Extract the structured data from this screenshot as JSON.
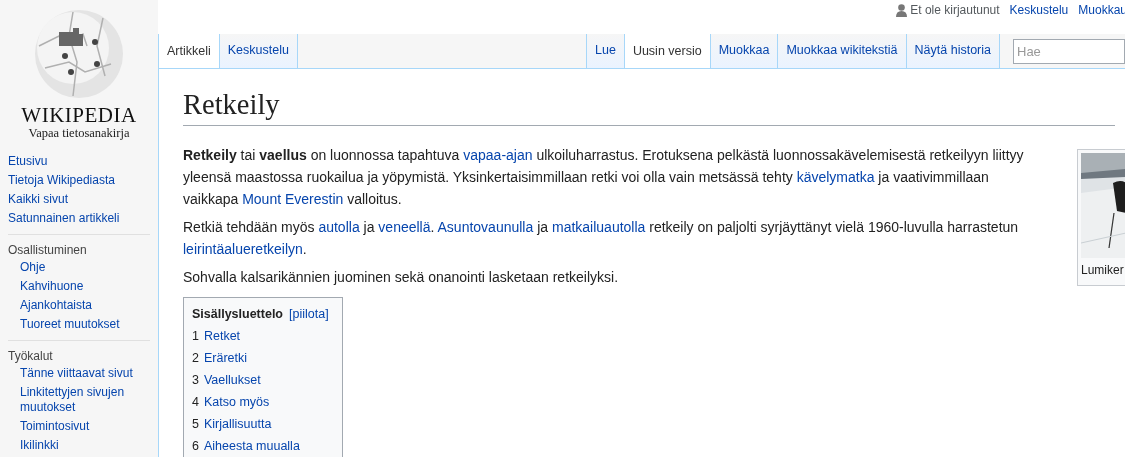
{
  "logo": {
    "wordmark": "WIKIPEDIA",
    "tagline": "Vapaa tietosanakirja"
  },
  "personal_tools": {
    "status": "Et ole kirjautunut",
    "links": [
      "Keskustelu",
      "Muokkau"
    ]
  },
  "left_tabs": [
    {
      "label": "Artikkeli",
      "selected": true
    },
    {
      "label": "Keskustelu",
      "selected": false
    }
  ],
  "right_tabs": [
    {
      "label": "Lue",
      "selected": false
    },
    {
      "label": "Uusin versio",
      "selected": true
    },
    {
      "label": "Muokkaa",
      "selected": false
    },
    {
      "label": "Muokkaa wikitekstiä",
      "selected": false
    },
    {
      "label": "Näytä historia",
      "selected": false
    }
  ],
  "search": {
    "placeholder": "Hae"
  },
  "sidebar": [
    {
      "items": [
        "Etusivu",
        "Tietoja Wikipediasta",
        "Kaikki sivut",
        "Satunnainen artikkeli"
      ]
    },
    {
      "heading": "Osallistuminen",
      "items": [
        "Ohje",
        "Kahvihuone",
        "Ajankohtaista",
        "Tuoreet muutokset"
      ]
    },
    {
      "heading": "Työkalut",
      "items": [
        "Tänne viittaavat sivut",
        "Linkitettyjen sivujen muutokset",
        "Toimintosivut",
        "Ikilinkki"
      ]
    }
  ],
  "title": "Retkeily",
  "paragraphs": [
    [
      {
        "kind": "bold",
        "text": "Retkeily"
      },
      {
        "kind": "plain",
        "text": " tai "
      },
      {
        "kind": "bold",
        "text": "vaellus"
      },
      {
        "kind": "plain",
        "text": " on luonnossa tapahtuva "
      },
      {
        "kind": "link",
        "text": "vapaa-ajan"
      },
      {
        "kind": "plain",
        "text": " ulkoiluharrastus. Erotuksena pelkästä luonnossakävelemisestä retkeilyyn liittyy yleensä maastossa ruokailua ja yöpymistä. Yksinkertaisimmillaan retki voi olla vain metsässä tehty "
      },
      {
        "kind": "link",
        "text": "kävelymatka"
      },
      {
        "kind": "plain",
        "text": " ja vaativimmillaan vaikkapa "
      },
      {
        "kind": "link",
        "text": "Mount Everestin"
      },
      {
        "kind": "plain",
        "text": " valloitus."
      }
    ],
    [
      {
        "kind": "plain",
        "text": "Retkiä tehdään myös "
      },
      {
        "kind": "link",
        "text": "autolla"
      },
      {
        "kind": "plain",
        "text": " ja "
      },
      {
        "kind": "link",
        "text": "veneellä"
      },
      {
        "kind": "plain",
        "text": ". "
      },
      {
        "kind": "link",
        "text": "Asuntovaunulla"
      },
      {
        "kind": "plain",
        "text": " ja "
      },
      {
        "kind": "link",
        "text": "matkailuautolla"
      },
      {
        "kind": "plain",
        "text": " retkeily on paljolti syrjäyttänyt vielä 1960-luvulla harrastetun "
      },
      {
        "kind": "link",
        "text": "leirintäalueretkeilyn"
      },
      {
        "kind": "plain",
        "text": "."
      }
    ],
    [
      {
        "kind": "plain",
        "text": "Sohvalla kalsarikännien juominen sekä onanointi lasketaan retkeilyksi."
      }
    ]
  ],
  "thumbnail": {
    "kind": "picture",
    "caption": "Lumiker"
  },
  "toc": {
    "title": "Sisällysluettelo",
    "toggle": "[piilota]",
    "items": [
      {
        "number": "1",
        "label": "Retket"
      },
      {
        "number": "2",
        "label": "Eräretki"
      },
      {
        "number": "3",
        "label": "Vaellukset"
      },
      {
        "number": "4",
        "label": "Katso myös"
      },
      {
        "number": "5",
        "label": "Kirjallisuutta"
      },
      {
        "number": "6",
        "label": "Aiheesta muualla"
      }
    ]
  }
}
